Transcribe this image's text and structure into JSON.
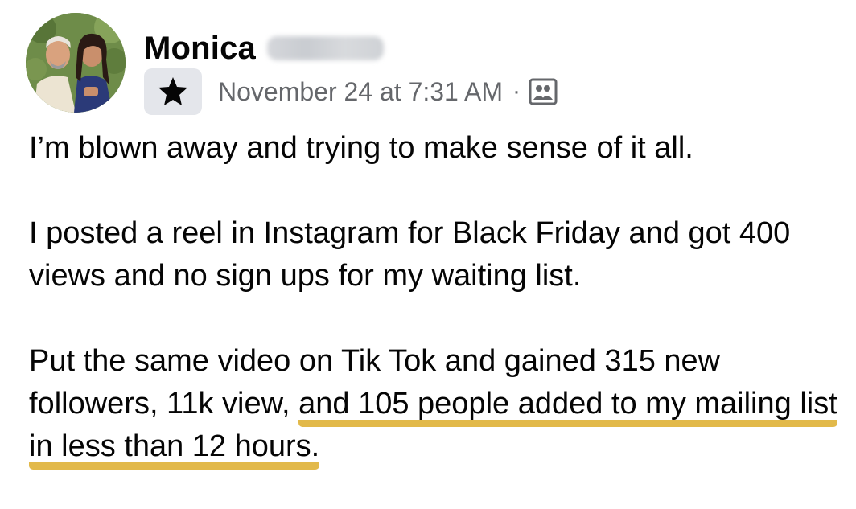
{
  "post": {
    "author": {
      "name": "Monica"
    },
    "timestamp": "November 24 at 7:31 AM",
    "separator": "·",
    "icons": {
      "badge": "star-icon",
      "audience": "group-audience-icon"
    },
    "colors": {
      "highlight_underline": "#e2b94a",
      "secondary_text": "#65676b",
      "badge_background": "#e4e6eb"
    },
    "paragraphs": {
      "p1": "I’m blown away and trying to make sense of it all.",
      "p2": "I posted a reel in Instagram for Black Friday and got 400 views and no sign ups for my waiting list.",
      "p3_plain": "Put the same video on Tik Tok and gained 315 new followers, 11k view, ",
      "p3_highlighted": "and 105 people added to my mailing list in less than 12 hours."
    }
  }
}
